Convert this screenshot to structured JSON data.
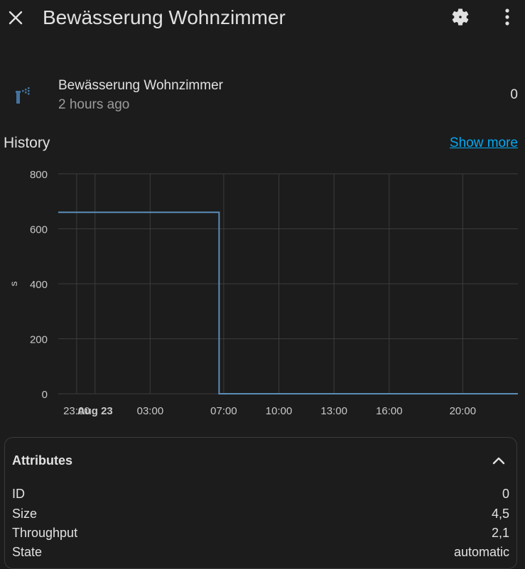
{
  "header": {
    "title": "Bewässerung Wohnzimmer"
  },
  "entity": {
    "name": "Bewässerung Wohnzimmer",
    "last_changed": "2 hours ago",
    "state": "0",
    "icon": "sprinkler-icon"
  },
  "history": {
    "title": "History",
    "show_more": "Show more"
  },
  "chart_data": {
    "type": "line",
    "ylabel": "s",
    "ylim": [
      0,
      800
    ],
    "y_ticks": [
      "800",
      "600",
      "400",
      "200",
      "0"
    ],
    "x_ticks": [
      "23:00",
      "Aug 23",
      "03:00",
      "07:00",
      "10:00",
      "13:00",
      "16:00",
      "20:00"
    ],
    "series": [
      {
        "x": [
          "22:30",
          "06:45",
          "06:45",
          "23:00"
        ],
        "values": [
          660,
          660,
          0,
          0
        ]
      }
    ],
    "line_color": "#5b8db8",
    "grid": true
  },
  "attributes": {
    "title": "Attributes",
    "rows": [
      {
        "key": "ID",
        "value": "0"
      },
      {
        "key": "Size",
        "value": "4,5"
      },
      {
        "key": "Throughput",
        "value": "2,1"
      },
      {
        "key": "State",
        "value": "automatic"
      }
    ]
  }
}
